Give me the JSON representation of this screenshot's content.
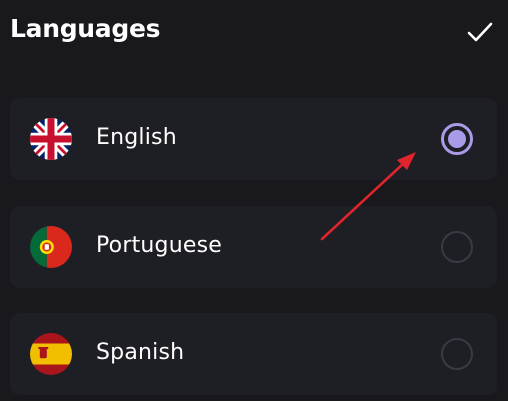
{
  "header": {
    "title": "Languages",
    "confirm_icon": "checkmark-icon"
  },
  "languages": [
    {
      "label": "English",
      "flag": "uk-flag-icon",
      "selected": true
    },
    {
      "label": "Portuguese",
      "flag": "portugal-flag-icon",
      "selected": false
    },
    {
      "label": "Spanish",
      "flag": "spain-flag-icon",
      "selected": false
    }
  ],
  "colors": {
    "background": "#18181d",
    "card": "#1e1e25",
    "accent": "#a99be8",
    "annotation_arrow": "#e0242b"
  }
}
